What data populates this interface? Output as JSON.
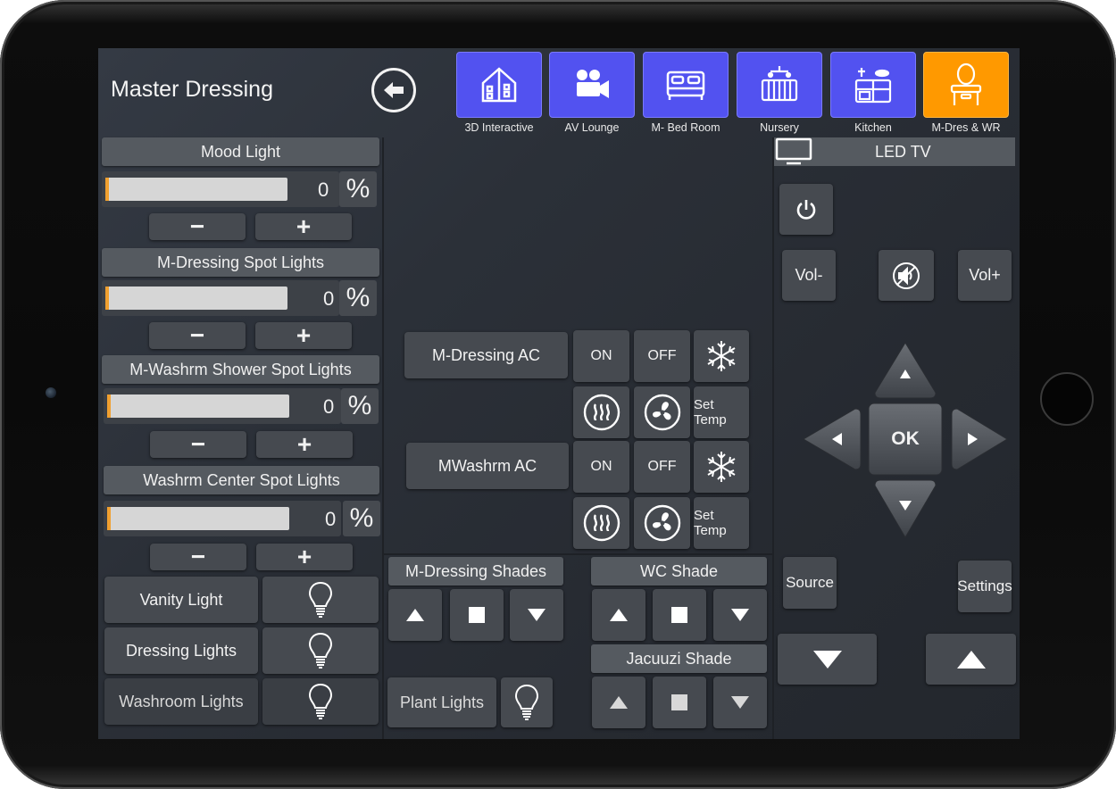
{
  "page_title": "Master Dressing",
  "rooms": [
    {
      "label": "3D Interactive",
      "icon": "house-3d-icon",
      "active": false
    },
    {
      "label": "AV Lounge",
      "icon": "video-camera-icon",
      "active": false
    },
    {
      "label": "M- Bed Room",
      "icon": "bed-icon",
      "active": false
    },
    {
      "label": "Nursery",
      "icon": "crib-icon",
      "active": false
    },
    {
      "label": "Kitchen",
      "icon": "kitchen-icon",
      "active": false
    },
    {
      "label": "M-Dres & WR",
      "icon": "vanity-mirror-icon",
      "active": true
    }
  ],
  "dimmers": [
    {
      "label": "Mood Light",
      "value": "0",
      "unit": "%",
      "level": 0
    },
    {
      "label": "M-Dressing Spot Lights",
      "value": "0",
      "unit": "%",
      "level": 0
    },
    {
      "label": "M-Washrm Shower Spot Lights",
      "value": "0",
      "unit": "%",
      "level": 0
    },
    {
      "label": "Washrm Center Spot Lights",
      "value": "0",
      "unit": "%",
      "level": 0
    }
  ],
  "minus_label": "−",
  "plus_label": "+",
  "switches": [
    {
      "label": "Vanity Light"
    },
    {
      "label": "Dressing Lights"
    },
    {
      "label": "Washroom Lights"
    }
  ],
  "ac_units": [
    {
      "label": "M-Dressing AC",
      "on": "ON",
      "off": "OFF",
      "set_temp": "Set Temp"
    },
    {
      "label": "MWashrm AC",
      "on": "ON",
      "off": "OFF",
      "set_temp": "Set Temp"
    }
  ],
  "shades": {
    "m_dressing": "M-Dressing Shades",
    "wc": "WC Shade",
    "jacuuzi": "Jacuuzi Shade"
  },
  "plant_lights": "Plant Lights",
  "tv": {
    "title": "LED TV",
    "vol_down": "Vol-",
    "vol_up": "Vol+",
    "ok": "OK",
    "source": "Source",
    "settings": "Settings"
  },
  "colors": {
    "room_tile": "#5252f0",
    "room_active": "#ff9900",
    "slider_fill": "#f0a030"
  }
}
